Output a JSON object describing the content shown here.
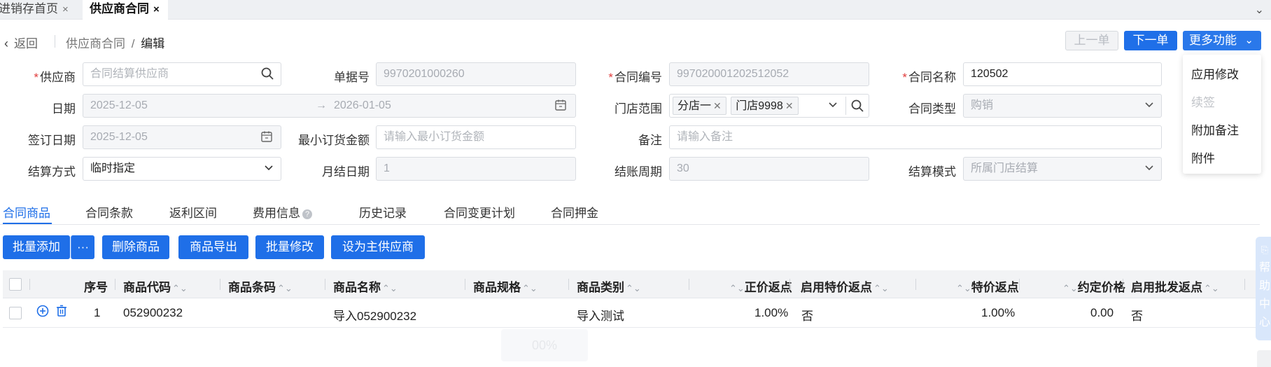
{
  "tabs": [
    {
      "label": "进销存首页",
      "close": "×"
    },
    {
      "label": "供应商合同",
      "close": "×"
    }
  ],
  "header": {
    "back": "返回",
    "breadcrumb_parent": "供应商合同",
    "breadcrumb_sep": "/",
    "breadcrumb_current": "编辑",
    "prev": "上一单",
    "next": "下一单",
    "more": "更多功能"
  },
  "more_menu": {
    "items": [
      {
        "label": "应用修改",
        "disabled": false
      },
      {
        "label": "续签",
        "disabled": true
      },
      {
        "label": "附加备注",
        "disabled": false
      },
      {
        "label": "附件",
        "disabled": false
      }
    ]
  },
  "form": {
    "supplier": {
      "label": "供应商",
      "placeholder": "合同结算供应商"
    },
    "doc_no": {
      "label": "单据号",
      "value": "9970201000260"
    },
    "contract_no": {
      "label": "合同编号",
      "value": "997020001202512052"
    },
    "contract_name": {
      "label": "合同名称",
      "value": "120502"
    },
    "date": {
      "label": "日期",
      "start": "2025-12-05",
      "arrow": "→",
      "end": "2026-01-05"
    },
    "store_scope": {
      "label": "门店范围",
      "tags": [
        "分店一",
        "门店9998"
      ]
    },
    "contract_type": {
      "label": "合同类型",
      "value": "购销"
    },
    "sign_date": {
      "label": "签订日期",
      "value": "2025-12-05"
    },
    "min_order": {
      "label": "最小订货金额",
      "placeholder": "请输入最小订货金额"
    },
    "remark": {
      "label": "备注",
      "placeholder": "请输入备注"
    },
    "settle_method": {
      "label": "结算方式",
      "value": "临时指定"
    },
    "month_settle_day": {
      "label": "月结日期",
      "value": "1"
    },
    "settle_period": {
      "label": "结账周期",
      "value": "30"
    },
    "settle_mode": {
      "label": "结算模式",
      "value": "所属门店结算"
    }
  },
  "subtabs": [
    "合同商品",
    "合同条款",
    "返利区间",
    "费用信息",
    "历史记录",
    "合同变更计划",
    "合同押金"
  ],
  "actions": {
    "batch_add": "批量添加",
    "more": "···",
    "delete": "删除商品",
    "export": "商品导出",
    "batch_edit": "批量修改",
    "set_main": "设为主供应商"
  },
  "table": {
    "headers": {
      "seq": "序号",
      "code": "商品代码",
      "barcode": "商品条码",
      "name": "商品名称",
      "spec": "商品规格",
      "category": "商品类别",
      "normal_rebate": "正价返点",
      "enable_special": "启用特价返点",
      "special_rebate": "特价返点",
      "agreed_price": "约定价格",
      "enable_wholesale": "启用批发返点"
    },
    "rows": [
      {
        "seq": "1",
        "code": "052900232",
        "barcode": "",
        "name": "导入052900232",
        "spec": "",
        "category": "导入测试",
        "normal_rebate": "1.00%",
        "enable_special": "否",
        "special_rebate": "1.00%",
        "agreed_price": "0.00",
        "enable_wholesale": "否"
      }
    ]
  },
  "ghost_text": "00%",
  "help_side": [
    "帮",
    "助",
    "中",
    "心"
  ],
  "colors": {
    "primary": "#1f6fe8",
    "required": "#e03b3b"
  }
}
